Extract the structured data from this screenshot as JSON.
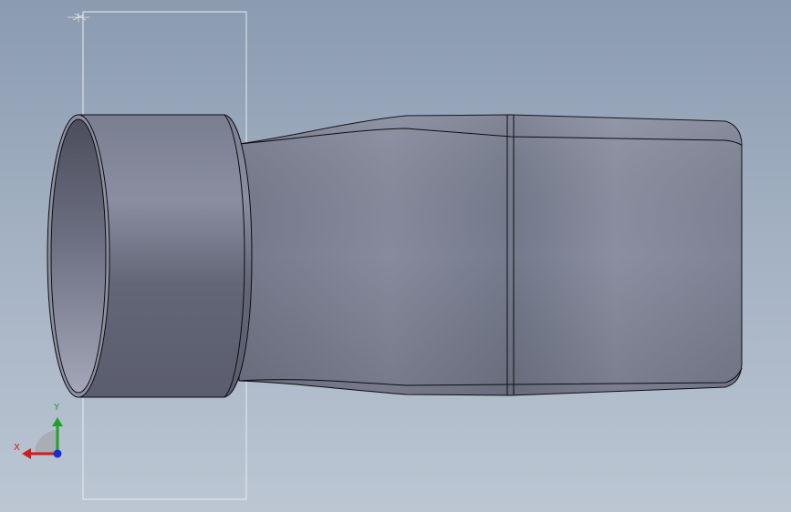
{
  "viewport": {
    "part": "revolved-loft-duct",
    "colors": {
      "background_top": "#8b9bb0",
      "background_bottom": "#bcc6d3",
      "part_dark": "#5d6070",
      "part_mid": "#7c8193",
      "part_light": "#9a9eaf",
      "edge": "#0d0d12",
      "bounding_box": "#e7ecf2"
    }
  },
  "triad": {
    "x_label": "X",
    "y_label": "Y",
    "x_color": "#d21b1b",
    "y_color": "#22a12a",
    "z_color": "#1a2dd0"
  }
}
